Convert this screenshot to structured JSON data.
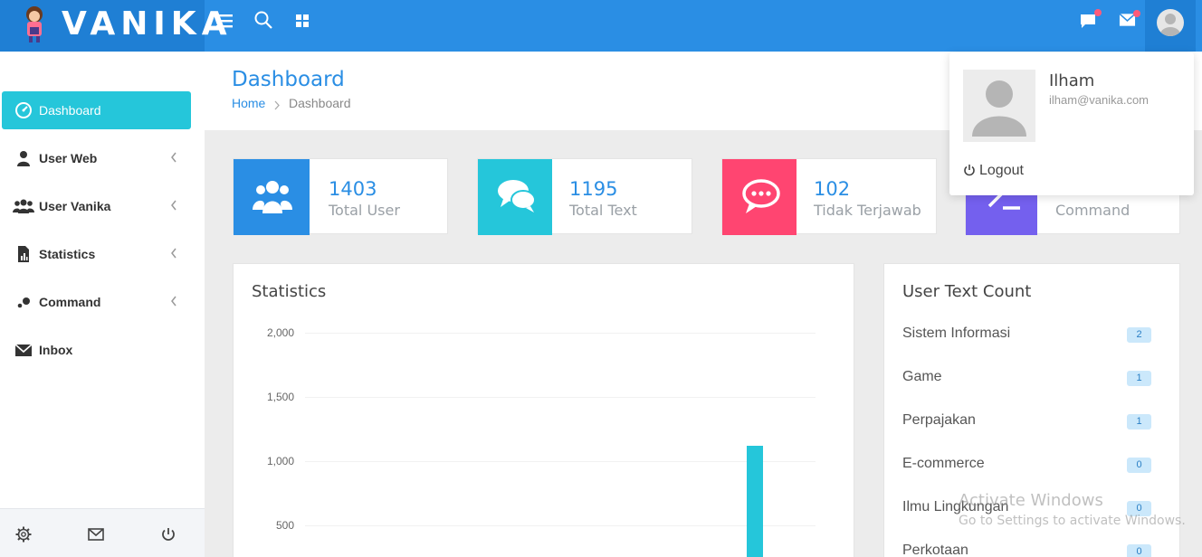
{
  "app": {
    "brand": "VANIKA",
    "accent": "#2a8ee4",
    "sidebar_active": "#25c6da"
  },
  "topbar": {
    "icons": [
      "menu-icon",
      "search-icon",
      "apps-grid-icon",
      "chat-icon",
      "mail-icon",
      "user-avatar-icon"
    ]
  },
  "sidebar": {
    "items": [
      {
        "label": "Dashboard",
        "icon": "dashboard-gauge-icon",
        "active": true
      },
      {
        "label": "User Web",
        "icon": "user-icon",
        "has_submenu": true
      },
      {
        "label": "User Vanika",
        "icon": "users-icon",
        "has_submenu": true
      },
      {
        "label": "Statistics",
        "icon": "report-file-icon",
        "has_submenu": true
      },
      {
        "label": "Command",
        "icon": "dots-icon",
        "has_submenu": true
      },
      {
        "label": "Inbox",
        "icon": "envelope-icon"
      }
    ],
    "footer_icons": [
      "settings-icon",
      "mail-icon",
      "power-icon"
    ]
  },
  "header": {
    "title": "Dashboard",
    "breadcrumb": [
      "Home",
      "Dashboard"
    ]
  },
  "stats": [
    {
      "value": "1403",
      "label": "Total User",
      "color": "#2a8ee4",
      "icon": "users-icon"
    },
    {
      "value": "1195",
      "label": "Total Text",
      "color": "#25c6da",
      "icon": "chat-bubbles-icon"
    },
    {
      "value": "102",
      "label": "Tidak Terjawab",
      "color": "#ff4571",
      "icon": "comment-dots-icon"
    },
    {
      "value": "",
      "label": "Command",
      "color": "#7460ee",
      "icon": "terminal-icon"
    }
  ],
  "statistics_panel": {
    "title": "Statistics"
  },
  "chart_data": {
    "type": "bar",
    "title": "Statistics",
    "yticks": [
      "2,000",
      "1,500",
      "1,000",
      "500"
    ],
    "ylim": [
      0,
      2000
    ],
    "values": [
      1130
    ],
    "grid": true
  },
  "user_text_count": {
    "title": "User Text Count",
    "rows": [
      {
        "label": "Sistem Informasi",
        "count": "2"
      },
      {
        "label": "Game",
        "count": "1"
      },
      {
        "label": "Perpajakan",
        "count": "1"
      },
      {
        "label": "E-commerce",
        "count": "0"
      },
      {
        "label": "Ilmu Lingkungan",
        "count": "0"
      },
      {
        "label": "Perkotaan",
        "count": "0"
      }
    ]
  },
  "user_dropdown": {
    "name": "Ilham",
    "email": "ilham@vanika.com",
    "logout_label": "Logout"
  },
  "watermark": {
    "line1": "Activate Windows",
    "line2": "Go to Settings to activate Windows."
  }
}
